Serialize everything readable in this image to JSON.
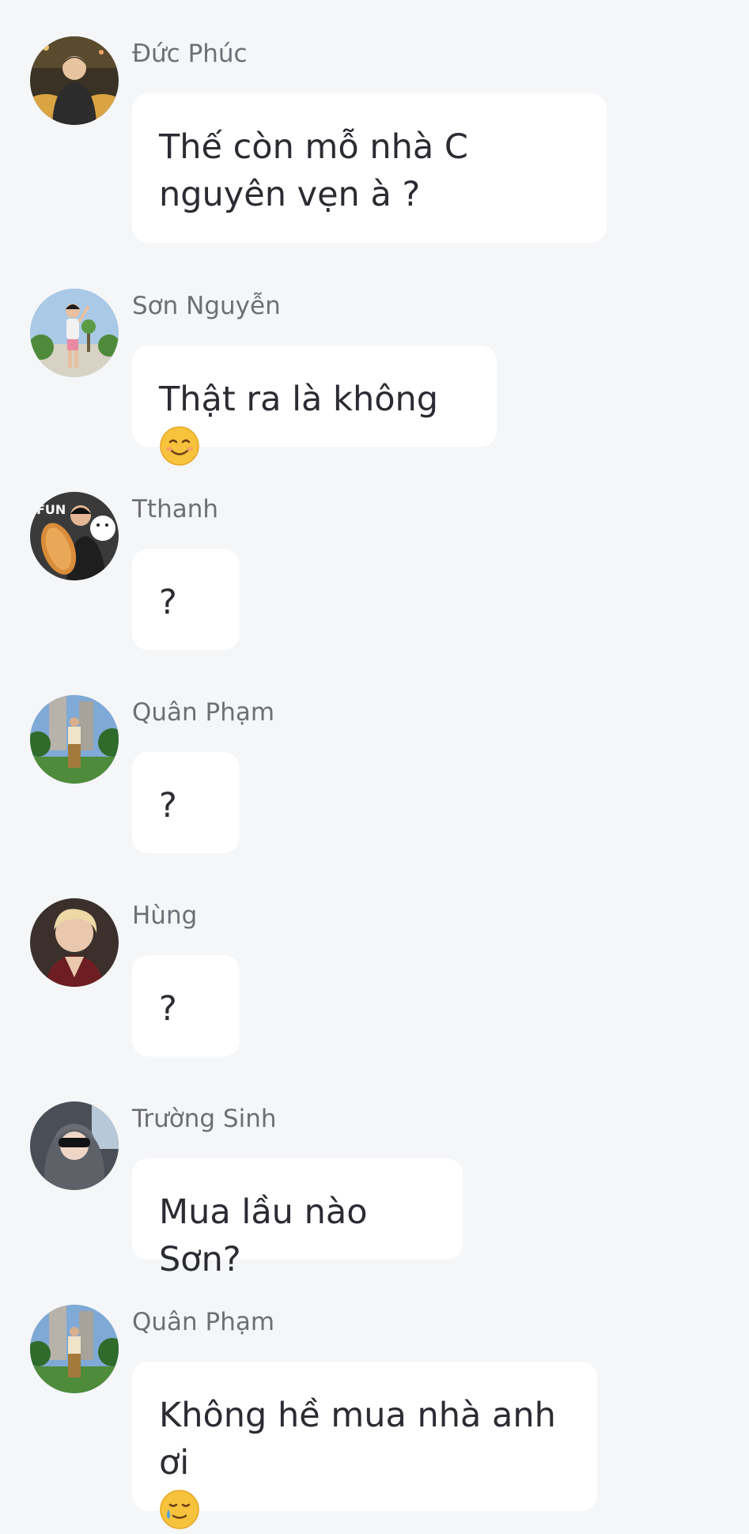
{
  "messages": [
    {
      "sender": "Đức Phúc",
      "text": "Thế còn mỗ nhà C nguyên vẹn à ?",
      "emoji": null,
      "avatar_icon": "user-avatar-icon"
    },
    {
      "sender": "Sơn Nguyễn",
      "text": "Thật ra là không",
      "emoji": "smiling-face-icon",
      "avatar_icon": "user-avatar-icon"
    },
    {
      "sender": "Tthanh",
      "text": "?",
      "emoji": null,
      "avatar_icon": "user-avatar-icon"
    },
    {
      "sender": "Quân Phạm",
      "text": "?",
      "emoji": null,
      "avatar_icon": "user-avatar-icon"
    },
    {
      "sender": "Hùng",
      "text": "?",
      "emoji": null,
      "avatar_icon": "user-avatar-icon"
    },
    {
      "sender": "Trường Sinh",
      "text": "Mua lầu nào Sơn?",
      "emoji": null,
      "avatar_icon": "user-avatar-icon"
    },
    {
      "sender": "Quân Phạm",
      "text": "Không hề mua nhà anh ơi",
      "emoji": "smiling-face-with-tear-icon",
      "avatar_icon": "user-avatar-icon"
    }
  ],
  "colors": {
    "background": "#f5f6f8",
    "bubble": "#ffffff",
    "sender_text": "#6d6f75",
    "message_text": "#2a2c31"
  }
}
